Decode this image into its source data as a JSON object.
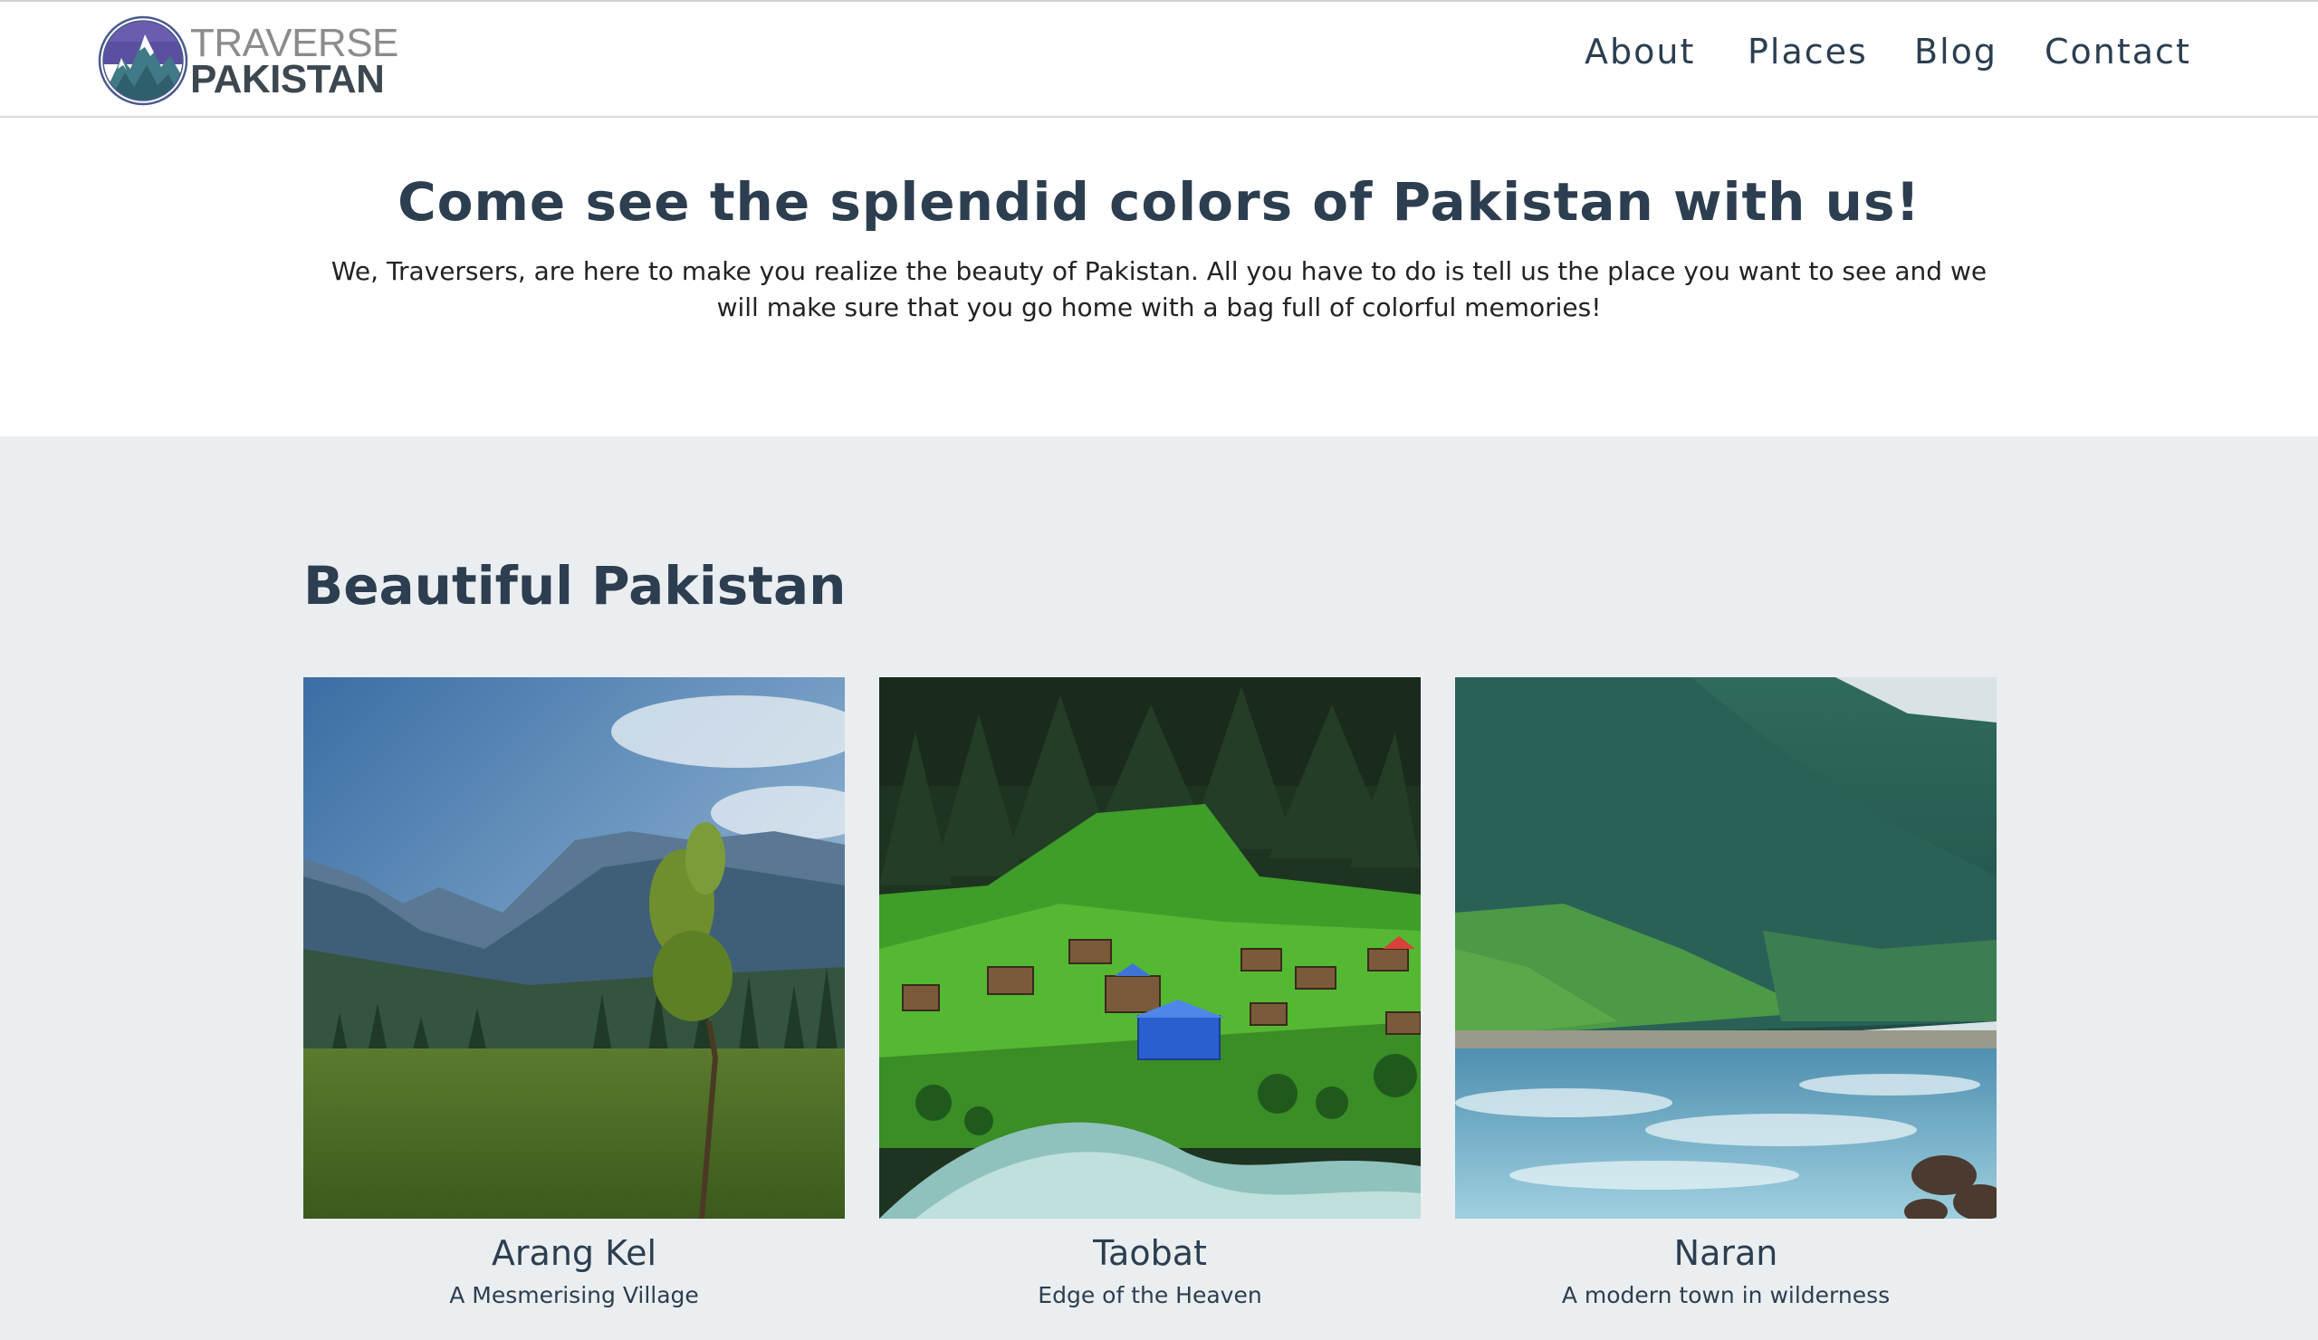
{
  "brand": {
    "name_top": "TRAVERSE",
    "name_bottom": "PAKISTAN",
    "colors": {
      "ring": "#4a5a8c",
      "mountain": "#3f6d8a",
      "text_dark": "#3d4750",
      "text_light": "#8c8c8c"
    }
  },
  "nav": {
    "items": [
      {
        "label": "About"
      },
      {
        "label": "Places"
      },
      {
        "label": "Blog"
      },
      {
        "label": "Contact"
      }
    ]
  },
  "hero": {
    "title": "Come see the splendid colors of Pakistan with us!",
    "text": "We, Traversers, are here to make you realize the beauty of Pakistan. All you have to do is tell us the place you want to see and we will make sure that you go home with a bag full of colorful memories!"
  },
  "gallery": {
    "title": "Beautiful Pakistan",
    "cards": [
      {
        "name": "Arang Kel",
        "subtitle": "A Mesmerising Village",
        "image": "mountain-meadow-photo"
      },
      {
        "name": "Taobat",
        "subtitle": "Edge of the Heaven",
        "image": "hillside-village-photo"
      },
      {
        "name": "Naran",
        "subtitle": "A modern town in wilderness",
        "image": "river-valley-photo"
      }
    ]
  },
  "colors": {
    "text": "#2c3e50",
    "gallery_bg": "#ebeef0",
    "header_border": "#d6dadd"
  }
}
